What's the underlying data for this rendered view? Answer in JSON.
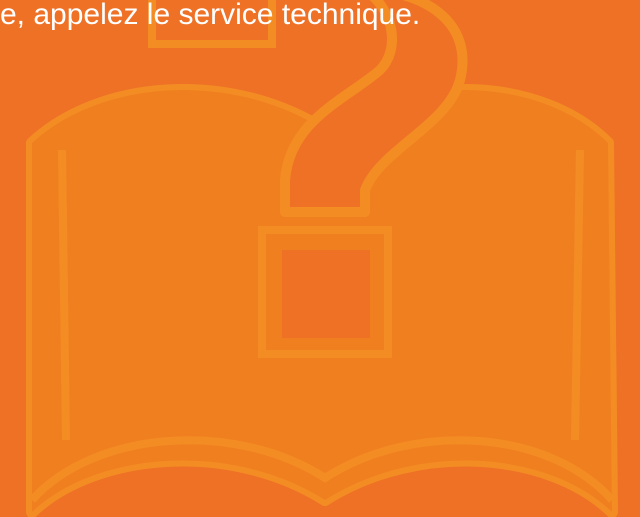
{
  "message": {
    "text": "e, appelez le service technique."
  },
  "illustration": {
    "icon": "book-question-icon",
    "background_color": "#ee7126",
    "book_color": "#f0801f",
    "outline_color": "#f48c24"
  }
}
